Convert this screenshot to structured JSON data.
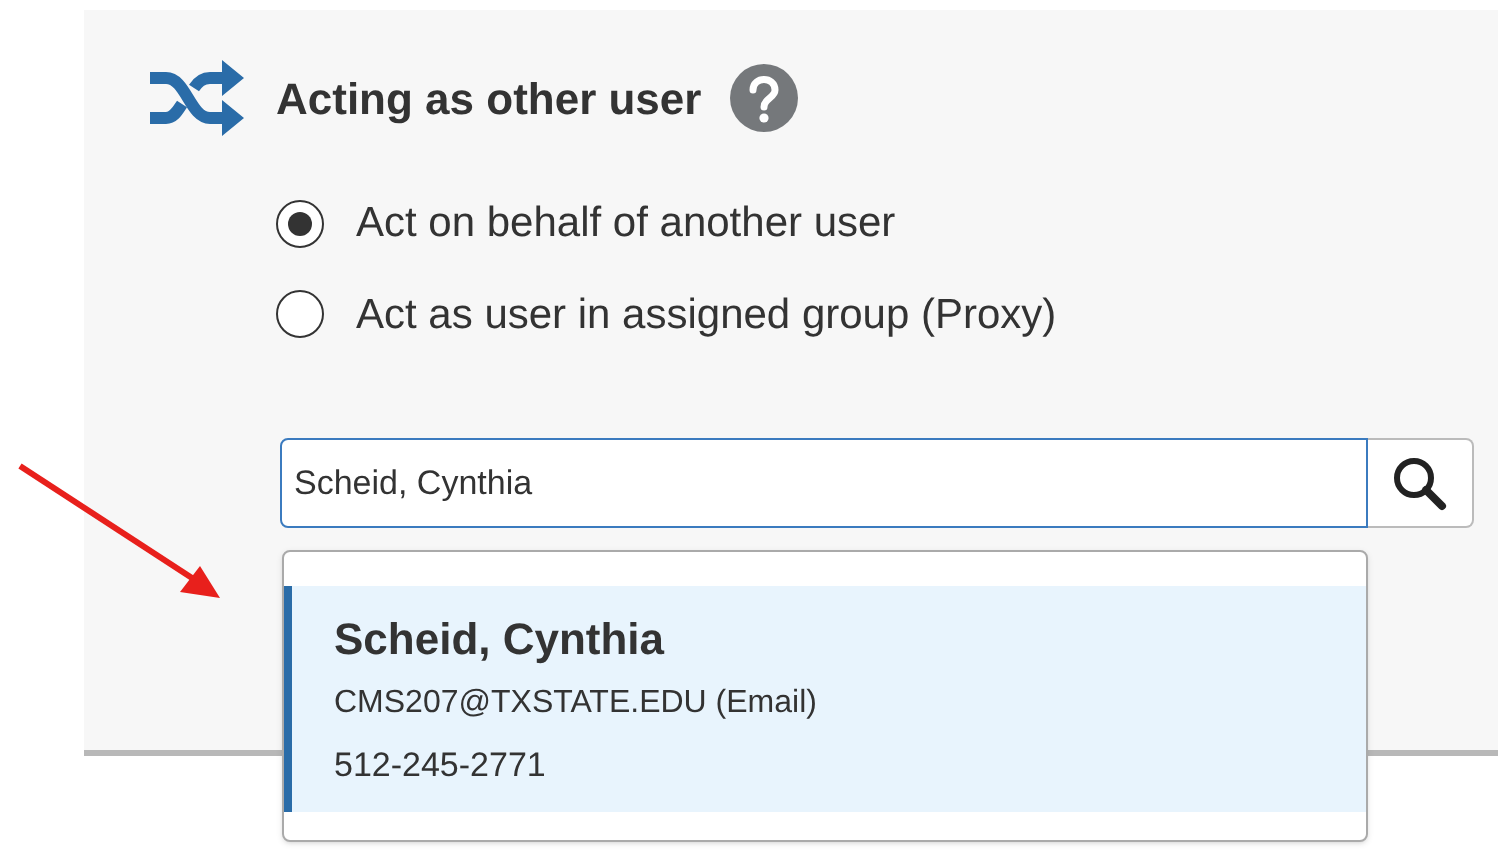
{
  "heading": {
    "title": "Acting as other user"
  },
  "options": [
    {
      "label": "Act on behalf of another user",
      "selected": true
    },
    {
      "label": "Act as user in assigned group (Proxy)",
      "selected": false
    }
  ],
  "search": {
    "value": "Scheid, Cynthia"
  },
  "results": [
    {
      "name": "Scheid, Cynthia",
      "email": "CMS207@TXSTATE.EDU (Email)",
      "phone": "512-245-2771",
      "selected": true
    }
  ]
}
